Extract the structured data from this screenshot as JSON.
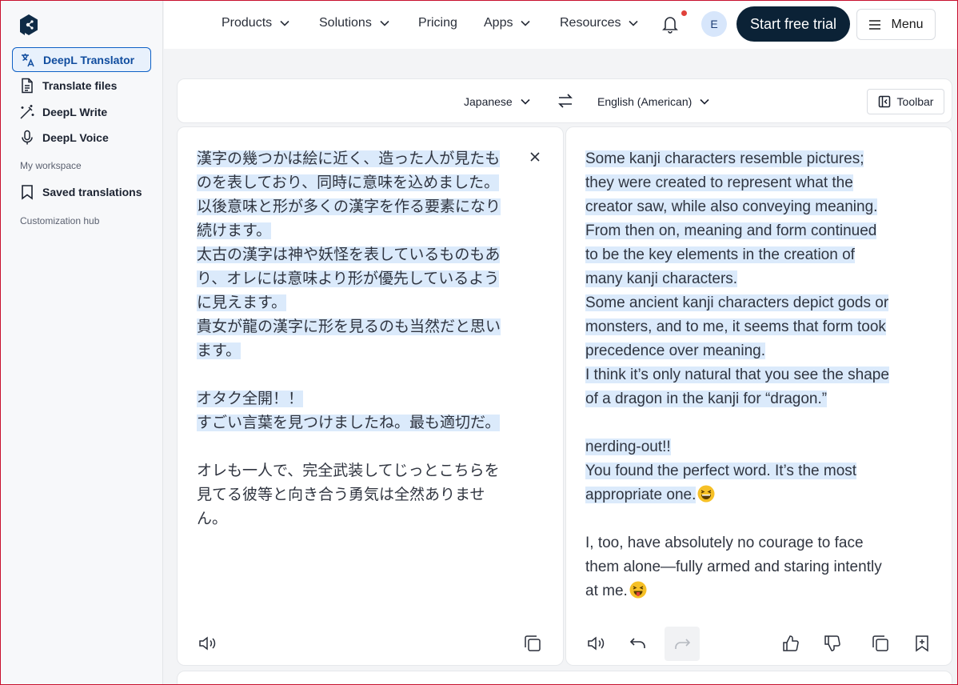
{
  "sidebar": {
    "items": [
      {
        "label": "DeepL Translator",
        "icon": "translate-icon"
      },
      {
        "label": "Translate files",
        "icon": "document-icon"
      },
      {
        "label": "DeepL Write",
        "icon": "magic-wand-icon"
      },
      {
        "label": "DeepL Voice",
        "icon": "microphone-icon"
      }
    ],
    "section_workspace": "My workspace",
    "saved_label": "Saved translations",
    "section_customization": "Customization hub"
  },
  "topbar": {
    "nav": [
      "Products",
      "Solutions",
      "Pricing",
      "Apps",
      "Resources"
    ],
    "avatar_initial": "E",
    "cta_label": "Start free trial",
    "menu_label": "Menu"
  },
  "langbar": {
    "source_lang": "Japanese",
    "target_lang": "English (American)",
    "toolbar_label": "Toolbar"
  },
  "source": {
    "lines": [
      {
        "text": "漢字の幾つかは絵に近く、造った人が見たも",
        "highlight": true
      },
      {
        "text": "のを表しており、同時に意味を込めました。",
        "highlight": true
      },
      {
        "text": "以後意味と形が多くの漢字を作る要素になり",
        "highlight": true
      },
      {
        "text": "続けます。",
        "highlight": true
      },
      {
        "text": "太古の漢字は神や妖怪を表しているものもあ",
        "highlight": true
      },
      {
        "text": "り、オレには意味より形が優先しているよう",
        "highlight": true
      },
      {
        "text": "に見えます。",
        "highlight": true
      },
      {
        "text": "貴女が龍の漢字に形を見るのも当然だと思い",
        "highlight": true
      },
      {
        "text": "ます。",
        "highlight": true
      },
      {
        "text": "",
        "highlight": false
      },
      {
        "text": "オタク全開！！",
        "highlight": true
      },
      {
        "text": "すごい言葉を見つけましたね。最も適切だ。",
        "highlight": true
      },
      {
        "text": "",
        "highlight": false
      },
      {
        "text": "オレも一人で、完全武装してじっとこちらを",
        "highlight": false
      },
      {
        "text": "見てる彼等と向き合う勇気は全然ありませ",
        "highlight": false
      },
      {
        "text": "ん。",
        "highlight": false
      }
    ]
  },
  "target": {
    "lines": [
      {
        "text": "Some kanji characters resemble pictures;",
        "highlight": true
      },
      {
        "text": "they were created to represent what the",
        "highlight": true
      },
      {
        "text": "creator saw, while also conveying meaning.",
        "highlight": true
      },
      {
        "text": "From then on, meaning and form continued",
        "highlight": true
      },
      {
        "text": "to be the key elements in the creation of",
        "highlight": true
      },
      {
        "text": "many kanji characters.",
        "highlight": true
      },
      {
        "text": "Some ancient kanji characters depict gods or",
        "highlight": true
      },
      {
        "text": "monsters, and to me, it seems that form took",
        "highlight": true
      },
      {
        "text": "precedence over meaning.",
        "highlight": true
      },
      {
        "text": "I think it’s only natural that you see the shape",
        "highlight": true
      },
      {
        "text": "of a dragon in the kanji for “dragon.”",
        "highlight": true
      },
      {
        "text": "",
        "highlight": false
      },
      {
        "text": "nerding-out!!",
        "highlight": true
      },
      {
        "text": "You found the perfect word. It’s the most",
        "highlight": true
      },
      {
        "text": "appropriate one.",
        "highlight": true,
        "emoji": "grin"
      },
      {
        "text": "",
        "highlight": false
      },
      {
        "text": "I, too, have absolutely no courage to face",
        "highlight": false
      },
      {
        "text": "them alone—fully armed and staring intently",
        "highlight": false
      },
      {
        "text": "at me.",
        "highlight": false,
        "emoji": "tongue"
      }
    ]
  },
  "colors": {
    "accent": "#0f61c6",
    "cta_bg": "#0b2236",
    "highlight": "#dbeafb",
    "notification": "#e0413a"
  }
}
